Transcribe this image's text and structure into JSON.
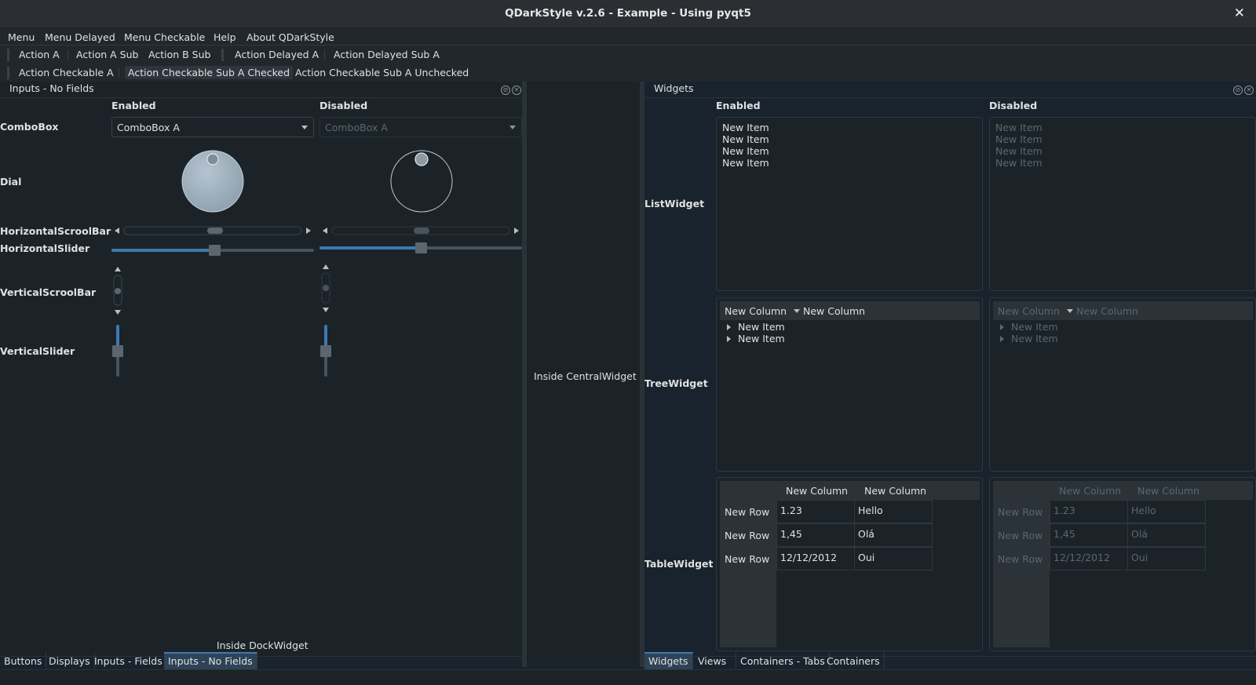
{
  "window": {
    "title": "QDarkStyle v.2.6 - Example - Using pyqt5",
    "close_glyph": "✕"
  },
  "menubar": {
    "items": [
      "Menu",
      "Menu Delayed",
      "Menu Checkable",
      "Help",
      "About QDarkStyle"
    ]
  },
  "toolbar1": {
    "items": [
      "Action A",
      "Action A Sub",
      "Action B Sub",
      "Action Delayed A",
      "Action Delayed Sub A"
    ]
  },
  "toolbar2": {
    "items": [
      "Action Checkable A",
      "Action Checkable Sub A Checked",
      "Action Checkable Sub A Unchecked"
    ]
  },
  "left_dock": {
    "title": "Inputs - No Fields",
    "enabled_header": "Enabled",
    "disabled_header": "Disabled",
    "labels": {
      "combobox": "ComboBox",
      "dial": "Dial",
      "hscrollbar": "HorizontalScroolBar",
      "hslider": "HorizontalSlider",
      "vscrollbar": "VerticalScroolBar",
      "vslider": "VerticalSlider"
    },
    "combo_enabled_value": "ComboBox A",
    "combo_disabled_value": "ComboBox A",
    "footer": "Inside DockWidget",
    "tabs": [
      "Buttons",
      "Displays",
      "Inputs - Fields",
      "Inputs - No Fields"
    ],
    "selected_tab": "Inputs - No Fields"
  },
  "central": {
    "text": "Inside CentralWidget"
  },
  "right_dock": {
    "title": "Widgets",
    "enabled_header": "Enabled",
    "disabled_header": "Disabled",
    "labels": {
      "list": "ListWidget",
      "tree": "TreeWidget",
      "table": "TableWidget"
    },
    "list_items": [
      "New Item",
      "New Item",
      "New Item",
      "New Item"
    ],
    "tree_columns": [
      "New Column",
      "New Column"
    ],
    "tree_items": [
      "New Item",
      "New Item"
    ],
    "table_columns": [
      "New Column",
      "New Column"
    ],
    "table_rows": [
      {
        "header": "New Row",
        "cells": [
          "1.23",
          "Hello"
        ]
      },
      {
        "header": "New Row",
        "cells": [
          "1,45",
          "Olá"
        ]
      },
      {
        "header": "New Row",
        "cells": [
          "12/12/2012",
          "Oui"
        ]
      }
    ],
    "tabs": [
      "Widgets",
      "Views",
      "Containers - Tabs",
      "Containers"
    ],
    "selected_tab": "Widgets"
  },
  "colors": {
    "accent": "#3c7ab1",
    "background": "#19232d",
    "text": "#dfe1e2",
    "disabled_text": "#5c666e"
  }
}
